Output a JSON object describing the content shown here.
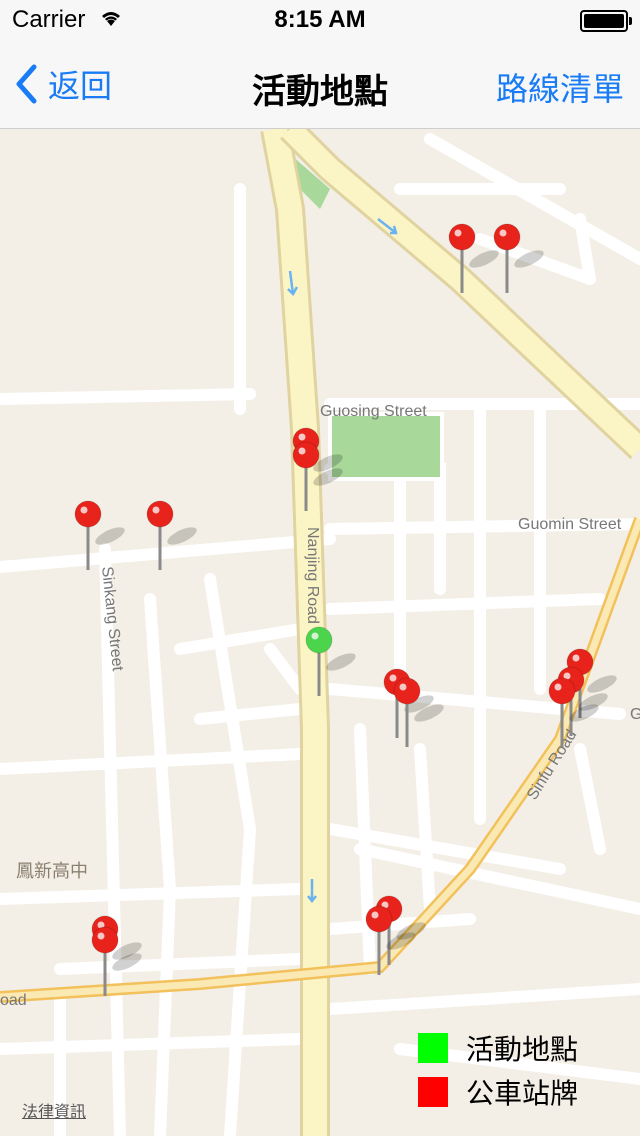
{
  "status_bar": {
    "carrier": "Carrier",
    "time": "8:15 AM"
  },
  "nav": {
    "back_label": "返回",
    "title": "活動地點",
    "right_label": "路線清單"
  },
  "map": {
    "streets": {
      "guosing": "Guosing Street",
      "guomin": "Guomin Street",
      "nanjing": "Nanjing Road",
      "sinkang": "Sinkang Street",
      "sinfu": "Sinfu Road",
      "road_fragment": "oad",
      "edge_fragment": "G"
    },
    "landmark": "鳳新高中",
    "legal_link": "法律資訊"
  },
  "legend": [
    {
      "label": "活動地點",
      "color": "#00ff00"
    },
    {
      "label": "公車站牌",
      "color": "#ff0000"
    }
  ],
  "colors": {
    "accent": "#1a7cf4",
    "pin_red": "#e8231b",
    "pin_green": "#4cd44c"
  }
}
